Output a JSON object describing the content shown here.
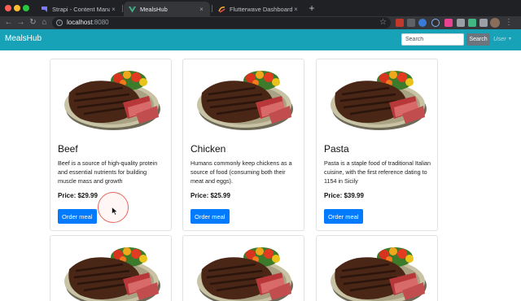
{
  "browser": {
    "tabs": [
      {
        "title": "Strapi - Content Manager",
        "close": "×",
        "icon": "strapi-favicon"
      },
      {
        "title": "MealsHub",
        "close": "×",
        "icon": "vue-favicon"
      },
      {
        "title": "Flutterwave Dashboard",
        "close": "×",
        "icon": "flutterwave-favicon"
      }
    ],
    "new_tab": "+",
    "nav": {
      "back": "←",
      "forward": "→",
      "reload": "↻",
      "home": "⌂"
    },
    "url": {
      "host": "localhost",
      "port": ":8080"
    },
    "star": "☆",
    "menu": "⋮"
  },
  "navbar": {
    "brand": "MealsHub",
    "search_placeholder": "Search",
    "search_button": "Search",
    "user_menu": "User",
    "accent": "#17a2b8"
  },
  "meals": [
    {
      "title": "Beef",
      "description": "Beef is a source of high-quality protein and essential nutrients for building muscle mass and growth",
      "price": "Price: $29.99",
      "button": "Order meal"
    },
    {
      "title": "Chicken",
      "description": "Humans commonly keep chickens as a source of food (consuming both their meat and eggs).",
      "price": "Price: $25.99",
      "button": "Order meal"
    },
    {
      "title": "Pasta",
      "description": "Pasta is a staple food of traditional Italian cuisine, with the first reference dating to 1154 in Sicily",
      "price": "Price: $39.99",
      "button": "Order meal"
    }
  ],
  "colors": {
    "primary_button": "#007bff",
    "secondary_button": "#6c757d"
  }
}
